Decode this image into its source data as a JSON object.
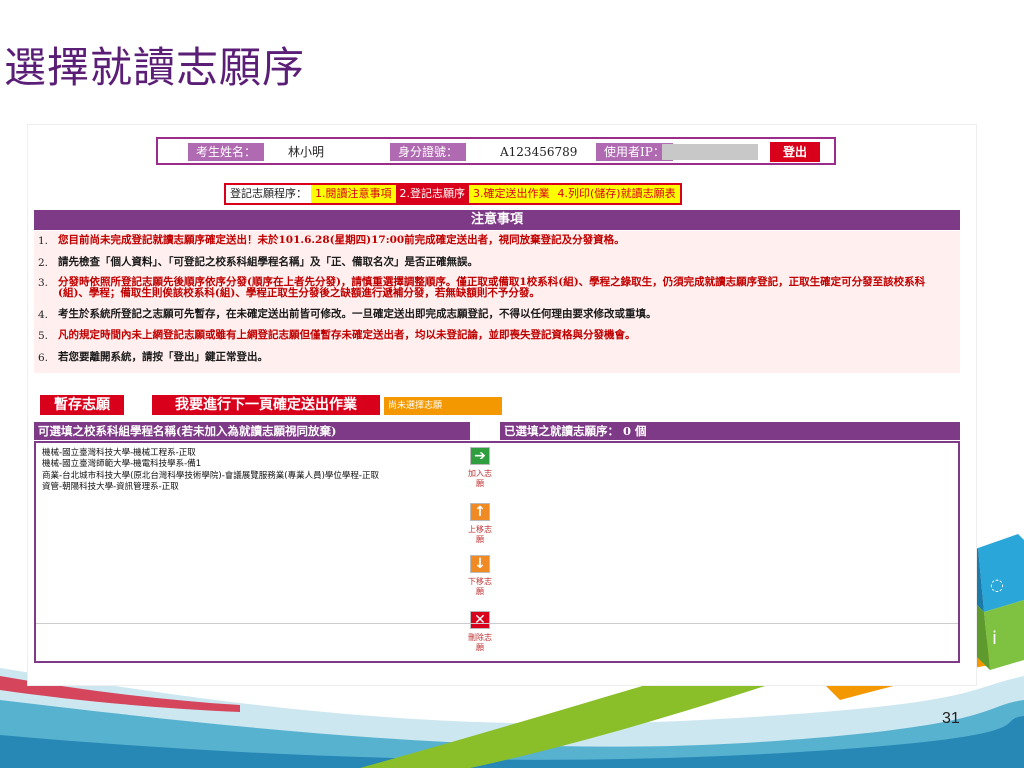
{
  "slide": {
    "title": "選擇就讀志願序",
    "page_number": "31"
  },
  "info_bar": {
    "name_label": "考生姓名：",
    "name_value": "林小明",
    "id_label": "身分證號：",
    "id_value": "A123456789",
    "ip_label": "使用者IP：",
    "logout_label": "登出"
  },
  "steps": {
    "prefix": "登記志願程序：",
    "items": [
      {
        "label": "1.閱讀注意事項",
        "bg": "#ffff00",
        "fg": "#d9001b"
      },
      {
        "label": "2.登記志願序",
        "bg": "#d9001b",
        "fg": "#ffffff"
      },
      {
        "label": "3.確定送出作業",
        "bg": "#ffff00",
        "fg": "#d9001b"
      },
      {
        "label": "4.列印(儲存)就讀志願表",
        "bg": "#ffff00",
        "fg": "#d9001b"
      }
    ]
  },
  "notice": {
    "heading": "注意事項",
    "items": [
      {
        "num": "1.",
        "text": "您目前尚未完成登記就讀志願序確定送出！未於101.6.28(星期四)17:00前完成確定送出者，視同放棄登記及分發資格。",
        "color": "red"
      },
      {
        "num": "2.",
        "text": "請先檢查「個人資料」、「可登記之校系科組學程名稱」及「正、備取名次」是否正確無誤。",
        "color": "dark"
      },
      {
        "num": "3.",
        "text": "分發時依照所登記志願先後順序依序分發(順序在上者先分發)，請慎重選擇調整順序。僅正取或備取1校系科(組)、學程之錄取生，仍須完成就讀志願序登記，正取生確定可分發至該校系科(組)、學程；備取生則俟該校系科(組)、學程正取生分發後之缺額進行遞補分發，若無缺額則不予分發。",
        "color": "red"
      },
      {
        "num": "4.",
        "text": "考生於系統所登記之志願可先暫存，在未確定送出前皆可修改。一旦確定送出即完成志願登記，不得以任何理由要求修改或重填。",
        "color": "dark"
      },
      {
        "num": "5.",
        "text": "凡的規定時間內未上網登記志願或雖有上網登記志願但僅暫存未確定送出者，均以未登記論，並即喪失登記資格與分發機會。",
        "color": "red"
      },
      {
        "num": "6.",
        "text": "若您要離開系統，請按「登出」鍵正常登出。",
        "color": "dark"
      }
    ]
  },
  "actions": {
    "save_label": "暫存志願",
    "next_label": "我要進行下一頁確定送出作業",
    "status_label": "尚未選擇志願"
  },
  "lists": {
    "available_header": "可選填之校系科組學程名稱(若未加入為就讀志願視同放棄)",
    "selected_header": "已選填之就讀志願序： 0  個",
    "available_items": [
      "機械-國立臺灣科技大學-機械工程系-正取",
      "機械-國立臺灣師範大學-機電科技學系-備1",
      "商業-台北城市科技大學(原北台灣科學技術學院)-會議展覽服務業(專業人員)學位學程-正取",
      "資管-朝陽科技大學-資訊管理系-正取"
    ]
  },
  "controls": {
    "add_label": "加入志願",
    "up_label": "上移志願",
    "down_label": "下移志願",
    "delete_label": "刪除志願"
  },
  "colors": {
    "accent_purple": "#7e3a87",
    "accent_red": "#d9001b",
    "title_purple": "#5b1e76"
  }
}
